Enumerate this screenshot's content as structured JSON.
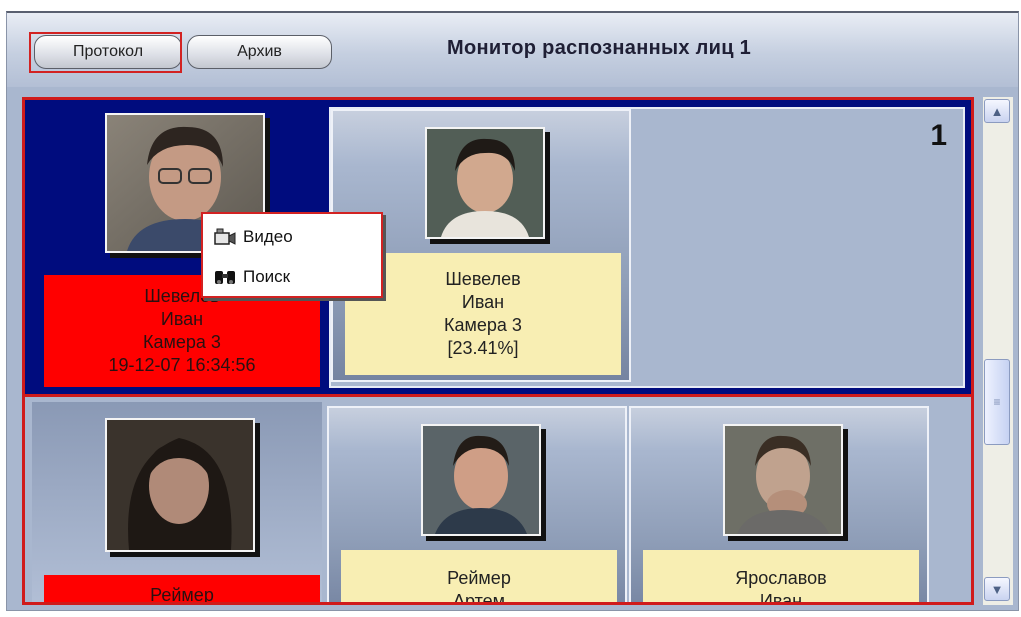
{
  "header": {
    "protocol_button": "Протокол",
    "archive_button": "Архив",
    "title": "Монитор распознанных лиц 1"
  },
  "groups": [
    {
      "number": "1",
      "detected": {
        "lines": [
          "Шевелев",
          "Иван",
          "Камера 3",
          "19-12-07 16:34:56"
        ]
      },
      "matches": [
        {
          "lines": [
            "Шевелев",
            "Иван",
            "Камера 3",
            "[23.41%]"
          ]
        }
      ]
    },
    {
      "detected": {
        "lines": [
          "Реймер"
        ]
      },
      "matches": [
        {
          "lines": [
            "Реймер",
            "Артем"
          ]
        },
        {
          "lines": [
            "Ярославов",
            "Иван"
          ]
        }
      ]
    }
  ],
  "context_menu": {
    "items": [
      {
        "label": "Видео",
        "icon": "camera-icon"
      },
      {
        "label": "Поиск",
        "icon": "binoculars-icon"
      }
    ]
  },
  "colors": {
    "selected_group": "#000c7e",
    "detected_label": "#ff0000",
    "match_label": "#f8eeb3",
    "highlight": "#d22222"
  }
}
